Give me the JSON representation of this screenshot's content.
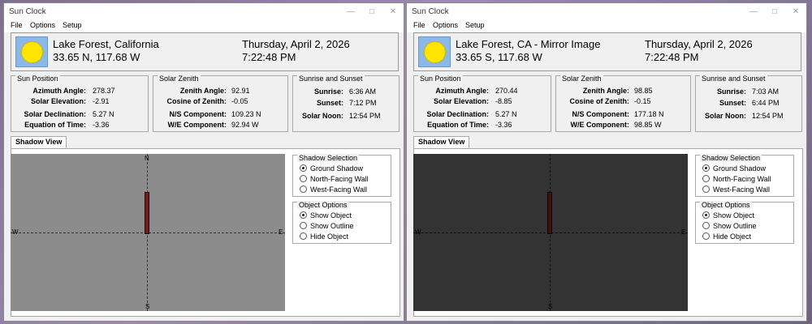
{
  "windows": [
    {
      "title": "Sun Clock",
      "menu": [
        "File",
        "Options",
        "Setup"
      ],
      "location": "Lake Forest, California",
      "coords": "33.65 N, 117.68 W",
      "date": "Thursday, April 2, 2026",
      "time": "7:22:48 PM",
      "sun_position": {
        "title": "Sun Position",
        "rows": [
          {
            "label": "Azimuth Angle:",
            "value": "278.37"
          },
          {
            "label": "Solar Elevation:",
            "value": "-2.91"
          },
          {
            "label": "Solar Declination:",
            "value": "5.27 N"
          },
          {
            "label": "Equation of Time:",
            "value": "-3.36"
          }
        ]
      },
      "solar_zenith": {
        "title": "Solar Zenith",
        "rows": [
          {
            "label": "Zenith Angle:",
            "value": "92.91"
          },
          {
            "label": "Cosine of Zenith:",
            "value": "-0.05"
          },
          {
            "label": "N/S Component:",
            "value": "109.23 N"
          },
          {
            "label": "W/E Component:",
            "value": "92.94 W"
          }
        ]
      },
      "sunrise_sunset": {
        "title": "Sunrise and Sunset",
        "rows": [
          {
            "label": "Sunrise:",
            "value": "6:36 AM"
          },
          {
            "label": "Sunset:",
            "value": "7:12 PM"
          },
          {
            "label": "Solar Noon:",
            "value": "12:54 PM"
          }
        ]
      },
      "tab_label": "Shadow View",
      "canvas_color": "#8c8c8c",
      "object_color": "#6b2020",
      "compass": {
        "n": "N",
        "s": "S",
        "e": "E",
        "w": "W"
      },
      "shadow_selection": {
        "title": "Shadow Selection",
        "options": [
          "Ground Shadow",
          "North-Facing Wall",
          "West-Facing Wall"
        ],
        "selected": 0
      },
      "object_options": {
        "title": "Object Options",
        "options": [
          "Show Object",
          "Show Outline",
          "Hide Object"
        ],
        "selected": 0
      }
    },
    {
      "title": "Sun Clock",
      "menu": [
        "File",
        "Options",
        "Setup"
      ],
      "location": "Lake Forest, CA - Mirror Image",
      "coords": "33.65 S, 117.68 W",
      "date": "Thursday, April 2, 2026",
      "time": "7:22:48 PM",
      "sun_position": {
        "title": "Sun Position",
        "rows": [
          {
            "label": "Azimuth Angle:",
            "value": "270.44"
          },
          {
            "label": "Solar Elevation:",
            "value": "-8.85"
          },
          {
            "label": "Solar Declination:",
            "value": "5.27 N"
          },
          {
            "label": "Equation of Time:",
            "value": "-3.36"
          }
        ]
      },
      "solar_zenith": {
        "title": "Solar Zenith",
        "rows": [
          {
            "label": "Zenith Angle:",
            "value": "98.85"
          },
          {
            "label": "Cosine of Zenith:",
            "value": "-0.15"
          },
          {
            "label": "N/S Component:",
            "value": "177.18 N"
          },
          {
            "label": "W/E Component:",
            "value": "98.85 W"
          }
        ]
      },
      "sunrise_sunset": {
        "title": "Sunrise and Sunset",
        "rows": [
          {
            "label": "Sunrise:",
            "value": "7:03 AM"
          },
          {
            "label": "Sunset:",
            "value": "6:44 PM"
          },
          {
            "label": "Solar Noon:",
            "value": "12:54 PM"
          }
        ]
      },
      "tab_label": "Shadow View",
      "canvas_color": "#333333",
      "object_color": "#3a1414",
      "compass": {
        "n": "",
        "s": "S",
        "e": "E",
        "w": "W"
      },
      "shadow_selection": {
        "title": "Shadow Selection",
        "options": [
          "Ground Shadow",
          "North-Facing Wall",
          "West-Facing Wall"
        ],
        "selected": 0
      },
      "object_options": {
        "title": "Object Options",
        "options": [
          "Show Object",
          "Show Outline",
          "Hide Object"
        ],
        "selected": 0
      }
    }
  ]
}
